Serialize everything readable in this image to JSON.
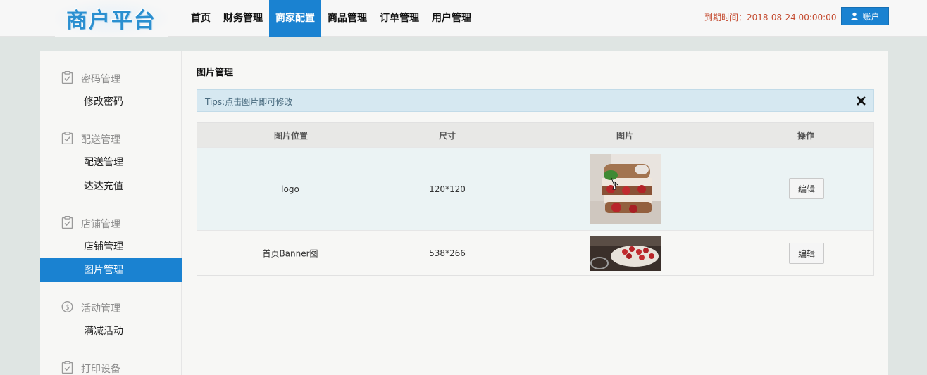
{
  "header": {
    "logo_text": "商户平台",
    "nav": [
      {
        "label": "首页"
      },
      {
        "label": "财务管理"
      },
      {
        "label": "商家配置",
        "active": true
      },
      {
        "label": "商品管理"
      },
      {
        "label": "订单管理"
      },
      {
        "label": "用户管理"
      }
    ],
    "expire_text": "到期时间：2018-08-24 00:00:00",
    "account_label": "账户"
  },
  "sidebar": {
    "groups": [
      {
        "label": "密码管理",
        "icon": "clipboard-check-icon",
        "items": [
          {
            "label": "修改密码"
          }
        ]
      },
      {
        "label": "配送管理",
        "icon": "clipboard-check-icon",
        "items": [
          {
            "label": "配送管理"
          },
          {
            "label": "达达充值"
          }
        ]
      },
      {
        "label": "店铺管理",
        "icon": "clipboard-check-icon",
        "items": [
          {
            "label": "店铺管理"
          },
          {
            "label": "图片管理",
            "active": true
          }
        ]
      },
      {
        "label": "活动管理",
        "icon": "dollar-circle-icon",
        "items": [
          {
            "label": "满减活动"
          }
        ]
      },
      {
        "label": "打印设备",
        "icon": "clipboard-check-icon",
        "items": []
      }
    ]
  },
  "content": {
    "title": "图片管理",
    "tips": "Tips:点击图片即可修改",
    "table": {
      "headers": [
        "图片位置",
        "尺寸",
        "图片",
        "操作"
      ],
      "rows": [
        {
          "position": "logo",
          "size": "120*120",
          "action": "编辑"
        },
        {
          "position": "首页Banner图",
          "size": "538*266",
          "action": "编辑"
        }
      ]
    }
  },
  "colors": {
    "accent": "#1a82d1",
    "expire_text": "#c44a2f",
    "tips_bg": "#d6e8f1"
  }
}
